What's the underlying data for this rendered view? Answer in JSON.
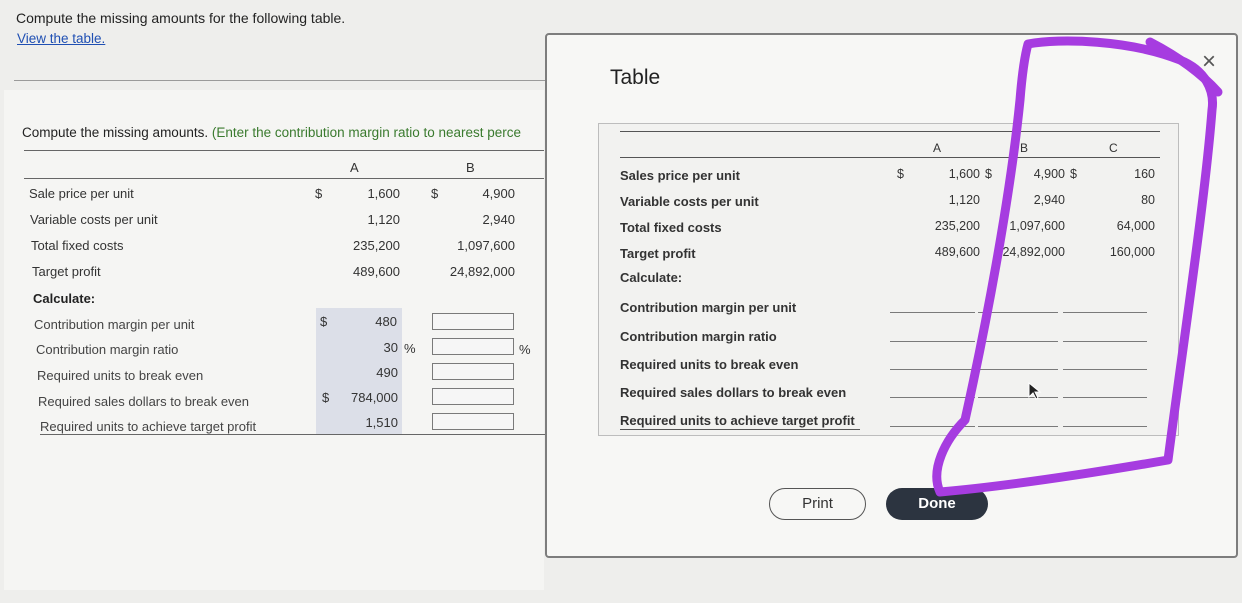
{
  "header": {
    "instruction": "Compute the missing amounts for the following table.",
    "link": "View the table."
  },
  "left": {
    "instruction_main": "Compute the missing amounts.",
    "instruction_note": "(Enter the contribution margin ratio to nearest perce",
    "col_a": "A",
    "col_b": "B",
    "currency": "$",
    "percent": "%",
    "rows": [
      {
        "label": "Sale price per unit",
        "a": "1,600",
        "b": "4,900"
      },
      {
        "label": "Variable costs per unit",
        "a": "1,120",
        "b": "2,940"
      },
      {
        "label": "Total fixed costs",
        "a": "235,200",
        "b": "1,097,600"
      },
      {
        "label": "Target profit",
        "a": "489,600",
        "b": "24,892,000"
      }
    ],
    "calculate_label": "Calculate:",
    "calc_rows": [
      {
        "label": "Contribution margin per unit",
        "a": "480"
      },
      {
        "label": "Contribution margin ratio",
        "a": "30"
      },
      {
        "label": "Required units to break even",
        "a": "490"
      },
      {
        "label": "Required sales dollars to break even",
        "a": "784,000"
      },
      {
        "label": "Required units to achieve target profit",
        "a": "1,510"
      }
    ]
  },
  "modal": {
    "title": "Table",
    "close": "×",
    "col_a": "A",
    "col_b": "B",
    "col_c": "C",
    "currency": "$",
    "rows": [
      {
        "label": "Sales price per unit",
        "a": "1,600",
        "b": "4,900",
        "c": "160"
      },
      {
        "label": "Variable costs per unit",
        "a": "1,120",
        "b": "2,940",
        "c": "80"
      },
      {
        "label": "Total fixed costs",
        "a": "235,200",
        "b": "1,097,600",
        "c": "64,000"
      },
      {
        "label": "Target profit",
        "a": "489,600",
        "b": "24,892,000",
        "c": "160,000"
      }
    ],
    "calculate_label": "Calculate:",
    "calc_rows": [
      {
        "label": "Contribution margin per unit"
      },
      {
        "label": "Contribution margin ratio"
      },
      {
        "label": "Required units to break even"
      },
      {
        "label": "Required sales dollars to break even"
      },
      {
        "label": "Required units to achieve target profit"
      }
    ],
    "print_label": "Print",
    "done_label": "Done"
  },
  "colors": {
    "annotation": "#a63ce0",
    "done_bg": "#2c3440",
    "link": "#1f4fb3"
  }
}
